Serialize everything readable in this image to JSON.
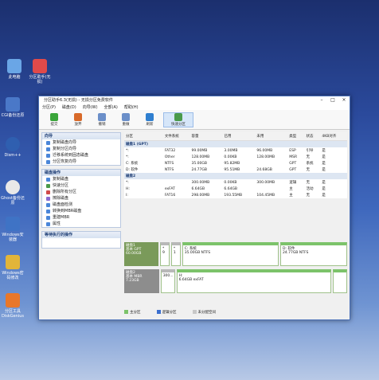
{
  "desktop": {
    "icons": [
      {
        "label": "此电脑"
      },
      {
        "label": "分区助手(无损)"
      },
      {
        "label": "CGI备份还原"
      },
      {
        "label": "Dism++"
      },
      {
        "label": "Ghost备份还原"
      },
      {
        "label": "Windows安装器"
      },
      {
        "label": "Windows密码修改"
      },
      {
        "label": "分区工具DiskGenius"
      }
    ]
  },
  "window": {
    "title": "分区助手6.3(无损) - 无损分区免费软件",
    "menu": [
      "分区(P)",
      "磁盘(D)",
      "向导(W)",
      "全部(A)",
      "帮助(H)"
    ],
    "toolbar": [
      {
        "label": "提交",
        "icon": "check-icon"
      },
      {
        "label": "放弃",
        "icon": "undo-icon"
      },
      {
        "label": "撤销",
        "icon": "back-icon"
      },
      {
        "label": "重做",
        "icon": "redo-icon"
      },
      {
        "label": "刷新",
        "icon": "refresh-icon"
      },
      {
        "label": "快速分区",
        "icon": "quick-partition-icon"
      }
    ],
    "wizard_panel": {
      "title": "向导",
      "items": [
        "复制磁盘向导",
        "复制分区向导",
        "迁移系统到固态磁盘",
        "分区恢复向导"
      ]
    },
    "disk_ops_panel": {
      "title": "磁盘操作",
      "items": [
        "复制磁盘",
        "快速分区",
        "删除所有分区",
        "擦除磁盘",
        "磁盘面检测",
        "转换到MBR磁盘",
        "重建MBR",
        "属性"
      ]
    },
    "pending_panel": {
      "title": "等待执行的操作"
    },
    "table": {
      "columns": [
        "分区",
        "文件系统",
        "容量",
        "已用",
        "未用",
        "类型",
        "状态",
        "4KB对齐"
      ],
      "rows": [
        {
          "disk": true,
          "cells": [
            "磁盘1 (GPT)",
            "",
            "",
            "",
            "",
            "",
            "",
            ""
          ]
        },
        {
          "cells": [
            "*:",
            "FAT32",
            "99.00MB",
            "3.00MB",
            "96.00MB",
            "ESP",
            "引导",
            "是"
          ]
        },
        {
          "cells": [
            "*:",
            "Other",
            "128.00MB",
            "0.00KB",
            "128.00MB",
            "MSR",
            "无",
            "是"
          ]
        },
        {
          "cells": [
            "C: 系统",
            "NTFS",
            "35.00GB",
            "95.82MB",
            "",
            "GPT",
            "系统",
            "是"
          ]
        },
        {
          "cells": [
            "D: 软件",
            "NTFS",
            "24.77GB",
            "95.51MB",
            "24.68GB",
            "GPT",
            "无",
            "是"
          ]
        },
        {
          "disk": true,
          "cells": [
            "磁盘2",
            "",
            "",
            "",
            "",
            "",
            "",
            ""
          ]
        },
        {
          "cells": [
            "*:",
            "",
            "300.00MB",
            "0.00KB",
            "300.00MB",
            "逻辑",
            "无",
            "是"
          ]
        },
        {
          "cells": [
            "H:",
            "exFAT",
            "6.64GB",
            "6.64GB",
            "",
            "主",
            "活动",
            "是"
          ]
        },
        {
          "cells": [
            "I:",
            "FAT16",
            "298.00MB",
            "193.55MB",
            "104.45MB",
            "主",
            "无",
            "是"
          ]
        }
      ]
    },
    "disk_maps": [
      {
        "label_lines": [
          "磁盘1",
          "基本 GPT",
          "60.00GB"
        ],
        "parts": [
          {
            "title": "*",
            "sub": "9"
          },
          {
            "title": "*",
            "sub": "1"
          },
          {
            "title": "C: 系统",
            "sub": "35.00GB NTFS"
          },
          {
            "title": "D: 软件",
            "sub": "24.77GB NTFS"
          }
        ]
      },
      {
        "label_lines": [
          "磁盘2",
          "基本 MBR",
          "7.23GB"
        ],
        "parts": [
          {
            "title": "",
            "sub": "300..."
          },
          {
            "title": "H:",
            "sub": "6.64GB exFAT"
          },
          {
            "title": "",
            "sub": ""
          }
        ]
      }
    ],
    "legend": [
      {
        "label": "主分区",
        "color": "#7cc36a"
      },
      {
        "label": "逻辑分区",
        "color": "#3b6fcf"
      },
      {
        "label": "未分配空间",
        "color": "#c8c8c8"
      }
    ]
  }
}
